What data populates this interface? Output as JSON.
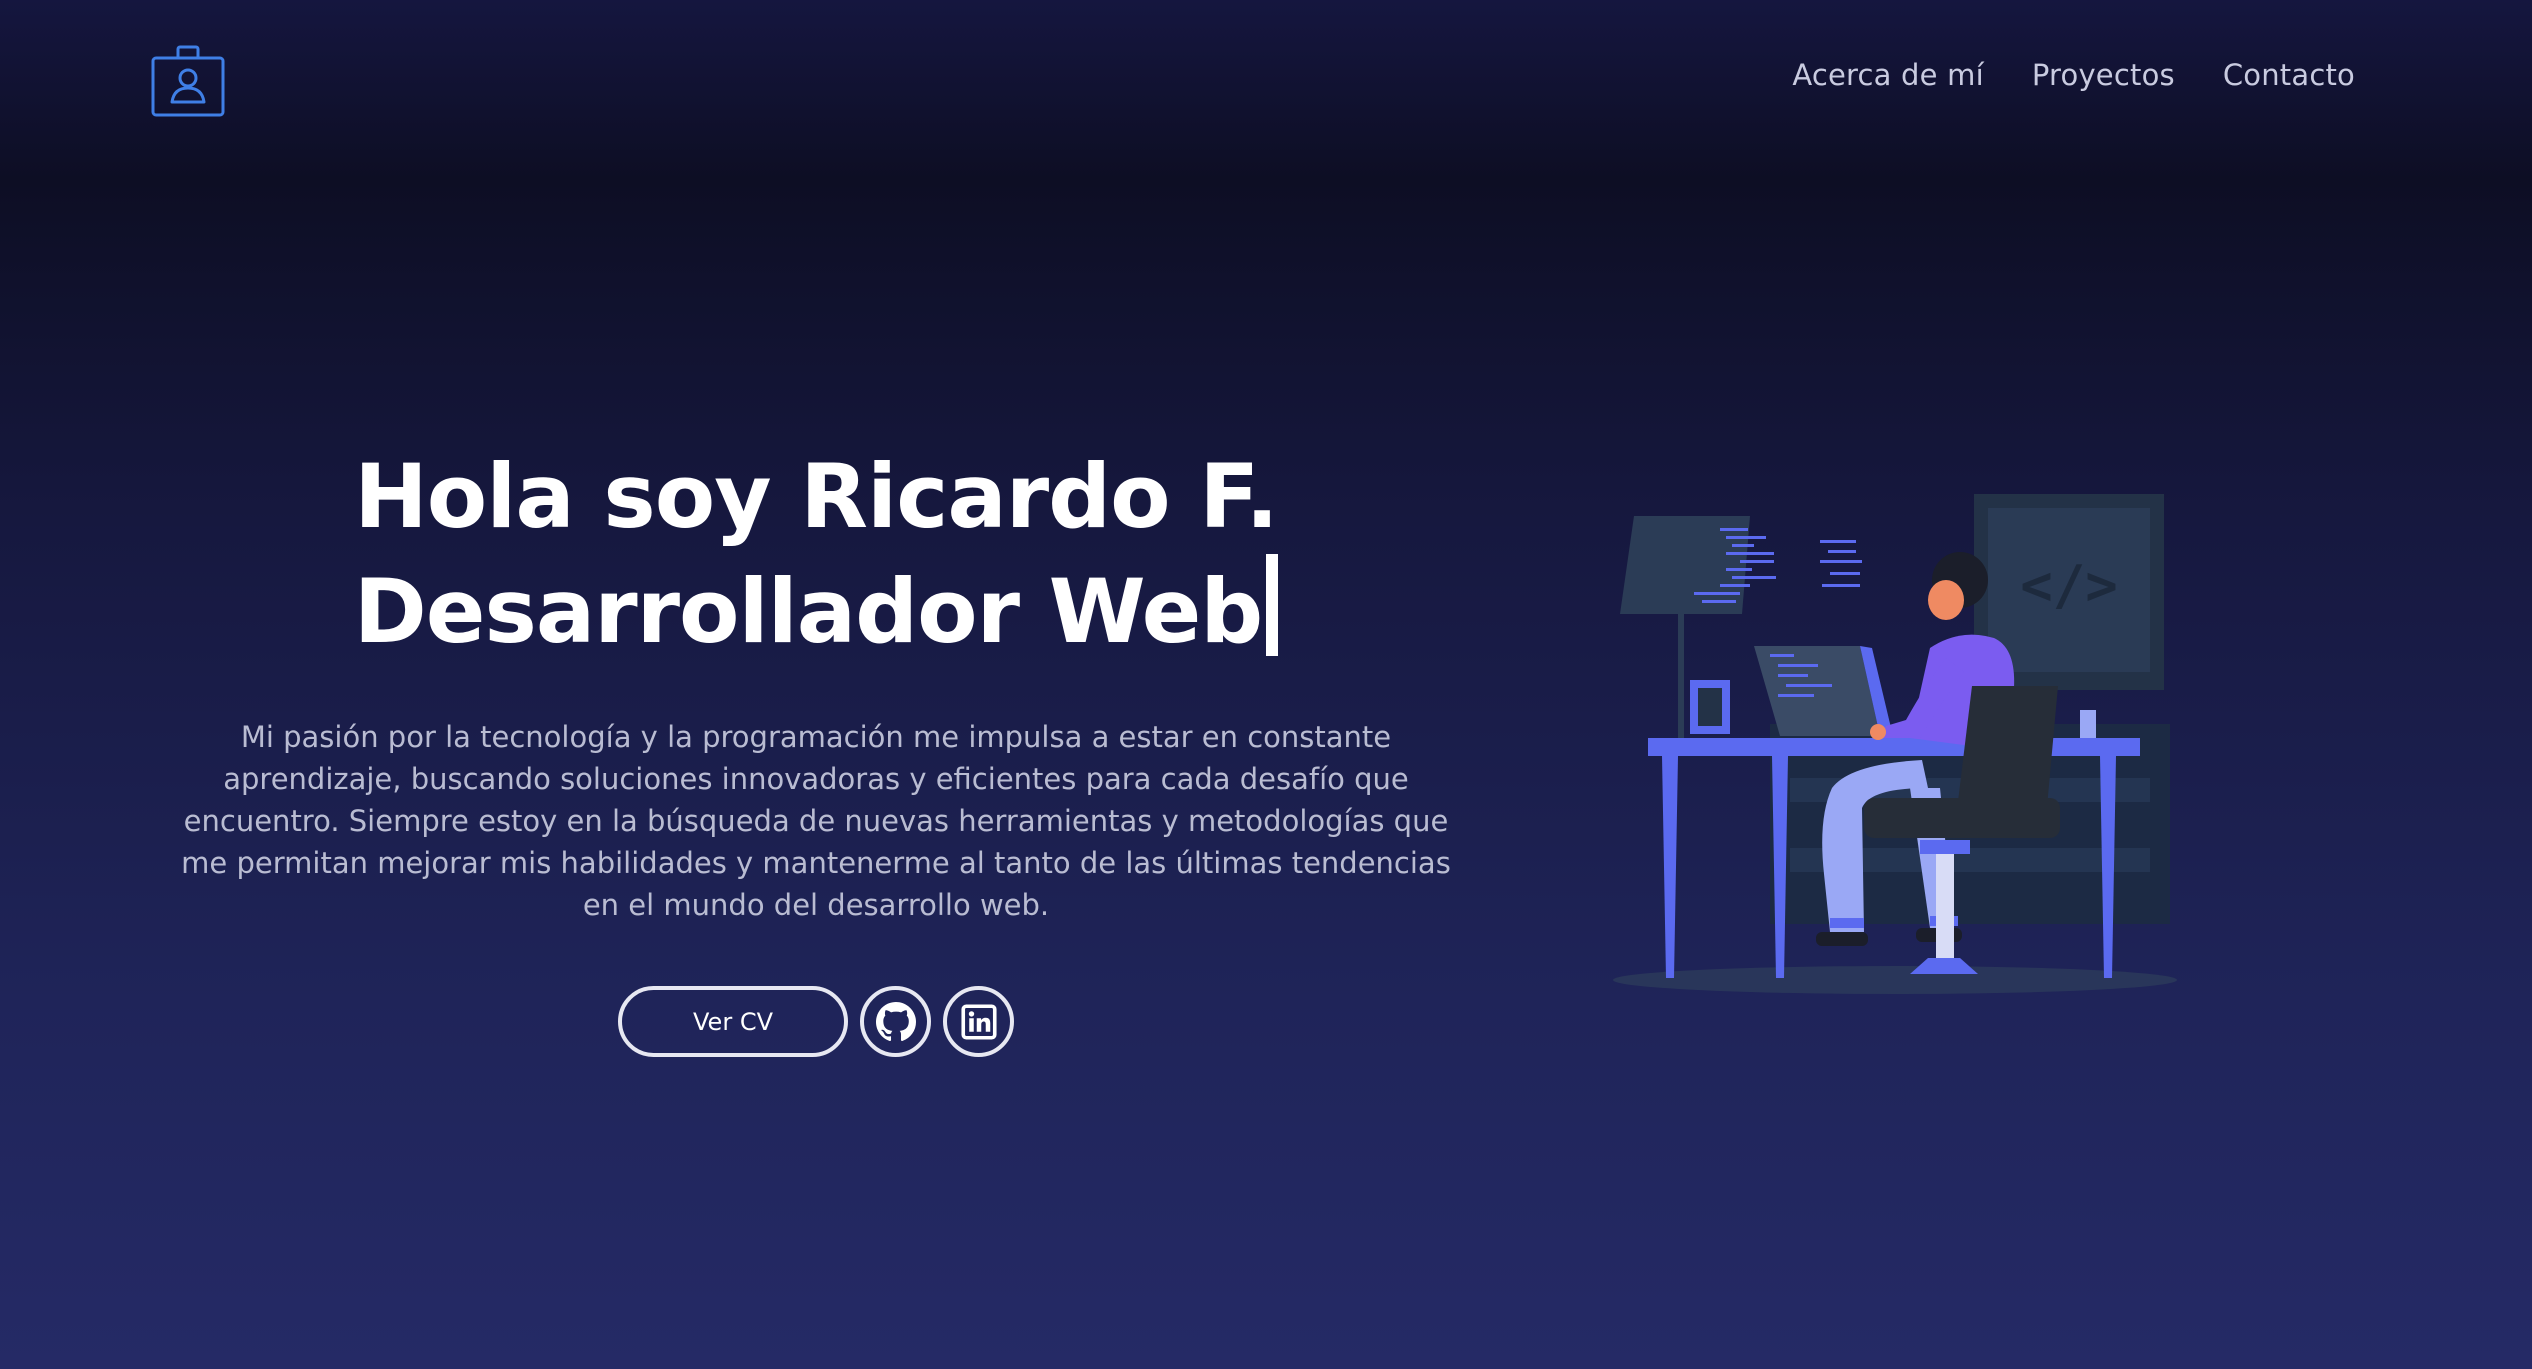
{
  "header": {
    "logo_icon": "id-badge-icon",
    "nav": [
      {
        "label": "Acerca de mí"
      },
      {
        "label": "Proyectos"
      },
      {
        "label": "Contacto"
      }
    ]
  },
  "hero": {
    "title_line1": "Hola soy Ricardo F.",
    "title_line2": "Desarrollador Web",
    "description": "Mi pasión por la tecnología y la programación me impulsa a estar en constante aprendizaje, buscando soluciones innovadoras y eficientes para cada desafío que encuentro. Siempre estoy en la búsqueda de nuevas herramientas y metodologías que me permitan mejorar mis habilidades y mantenerme al tanto de las últimas tendencias en el mundo del desarrollo web.",
    "cv_button": "Ver CV",
    "social": [
      {
        "icon": "github-icon"
      },
      {
        "icon": "linkedin-icon"
      }
    ],
    "illustration_code_glyph": "</>"
  },
  "colors": {
    "background_top": "#15163f",
    "background_bottom": "#252a66",
    "accent_blue": "#5b6af0",
    "accent_purple": "#7b5cf0",
    "logo_blue": "#3f7fe6",
    "nav_text": "#c9cbe0",
    "desc_text": "#b9bcd2"
  }
}
